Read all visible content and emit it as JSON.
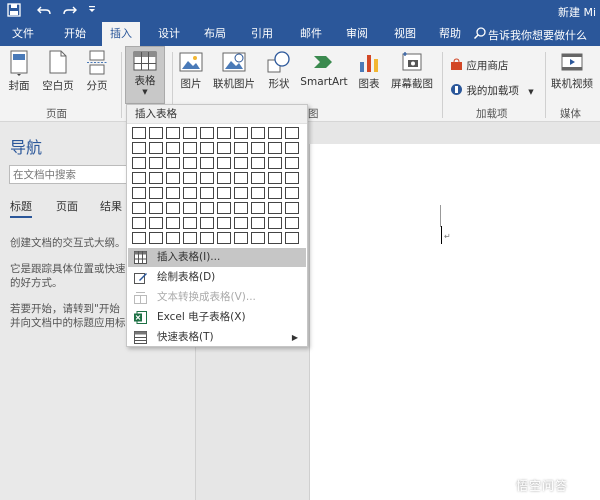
{
  "title_bar": {
    "title": "新建 Mi",
    "quick_access": [
      "save-icon",
      "undo-icon",
      "redo-icon",
      "customize-icon"
    ]
  },
  "tabs": [
    {
      "label": "文件"
    },
    {
      "label": "开始"
    },
    {
      "label": "插入",
      "active": true
    },
    {
      "label": "设计"
    },
    {
      "label": "布局"
    },
    {
      "label": "引用"
    },
    {
      "label": "邮件"
    },
    {
      "label": "审阅"
    },
    {
      "label": "视图"
    },
    {
      "label": "帮助"
    }
  ],
  "tell_me": "告诉我你想要做什么",
  "ribbon": {
    "pages": {
      "cover": "封面",
      "blank": "空白页",
      "break": "分页",
      "group": "页面"
    },
    "table": {
      "label": "表格"
    },
    "illustrations": {
      "picture": "图片",
      "online_picture": "联机图片",
      "shapes": "形状",
      "smartart": "SmartArt",
      "chart": "图表",
      "screenshot": "屏幕截图",
      "group_tail": "图"
    },
    "addins": {
      "store": "应用商店",
      "my_addins": "我的加载项",
      "group": "加载项"
    },
    "media": {
      "online_video": "联机视频",
      "group": "媒体"
    }
  },
  "nav": {
    "title": "导航",
    "search_placeholder": "在文档中搜索",
    "tabs": [
      "标题",
      "页面",
      "结果"
    ],
    "lines": [
      "创建文档的交互式大纲。",
      "它是跟踪具体位置或快速",
      "的好方式。",
      "若要开始，请转到\"开始",
      "并向文档中的标题应用标"
    ]
  },
  "dropdown": {
    "header": "插入表格",
    "grid": {
      "cols": 10,
      "rows": 8
    },
    "items": [
      {
        "label": "插入表格(I)...",
        "icon": "insert-table-icon",
        "highlighted": true
      },
      {
        "label": "绘制表格(D)",
        "icon": "draw-table-icon"
      },
      {
        "label": "文本转换成表格(V)...",
        "icon": "text-to-table-icon",
        "disabled": true
      },
      {
        "label": "Excel 电子表格(X)",
        "icon": "excel-icon"
      },
      {
        "label": "快速表格(T)",
        "icon": "quick-table-icon",
        "submenu": true
      }
    ]
  },
  "watermark": {
    "text": "悟空问答"
  },
  "colors": {
    "accent": "#2b579a",
    "ribbon_bg": "#f3f3f3",
    "nav_bg": "#e9e9e9"
  }
}
